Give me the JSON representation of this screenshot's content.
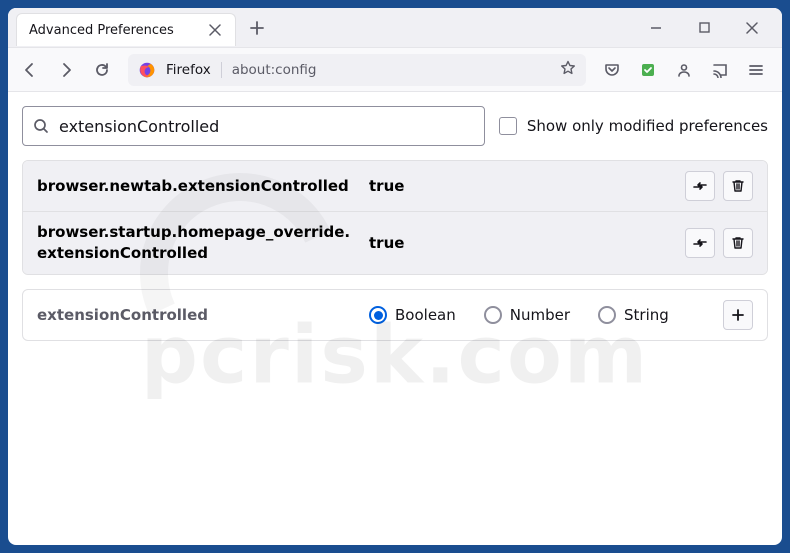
{
  "tab": {
    "title": "Advanced Preferences"
  },
  "url": {
    "identity": "Firefox",
    "path": "about:config"
  },
  "aboutconfig": {
    "search_value": "extensionControlled",
    "show_only_modified_label": "Show only modified preferences",
    "rows": [
      {
        "name": "browser.newtab.extensionControlled",
        "value": "true"
      },
      {
        "name": "browser.startup.homepage_override.extensionControlled",
        "value": "true"
      }
    ],
    "new_pref_name": "extensionControlled",
    "types": {
      "boolean": "Boolean",
      "number": "Number",
      "string": "String"
    }
  },
  "watermark": "pcrisk.com"
}
